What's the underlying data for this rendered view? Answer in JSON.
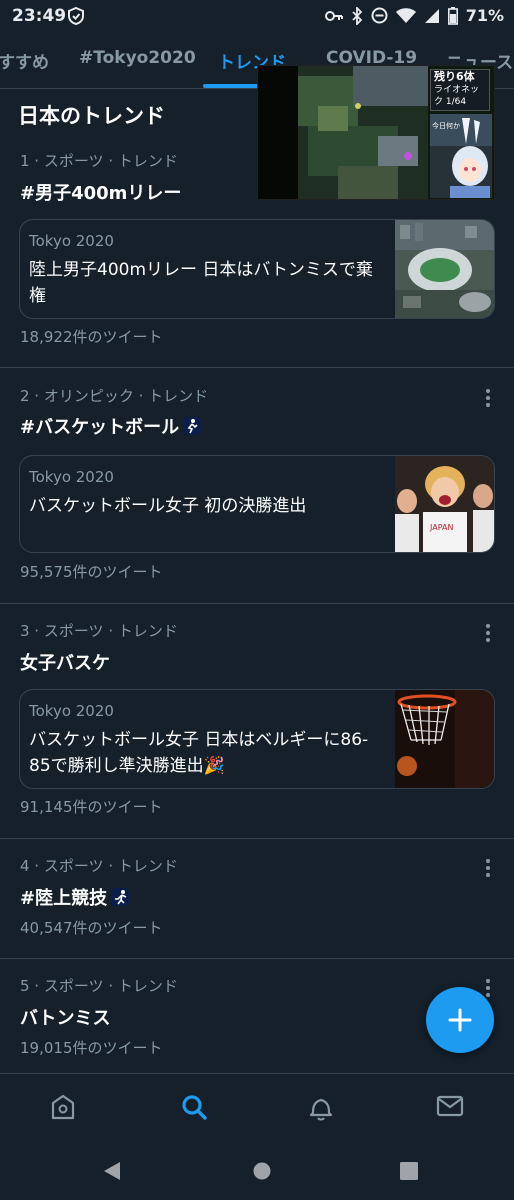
{
  "status_bar": {
    "time": "23:49",
    "battery": "71%"
  },
  "tabs": [
    {
      "label": "すすめ"
    },
    {
      "label": "#Tokyo2020"
    },
    {
      "label": "トレンド",
      "active": true
    },
    {
      "label": "COVID-19"
    },
    {
      "label": "ニュース"
    }
  ],
  "section_title": "日本のトレンド",
  "pip": {
    "rank_title": "残り6体",
    "rank_line": "ライオネック 1/64",
    "chat": "今日何か · シュ"
  },
  "trends": [
    {
      "meta": "1 · スポーツ · トレンド",
      "topic": "#男子400mリレー",
      "card": {
        "source": "Tokyo 2020",
        "text": "陸上男子400mリレー 日本はバトンミスで棄権",
        "image": "stadium-aerial-photo"
      },
      "count": "18,922件のツイート"
    },
    {
      "meta": "2 · オリンピック · トレンド",
      "topic": "#バスケットボール",
      "topic_icon": "basketball-player-emoji",
      "card": {
        "source": "Tokyo 2020",
        "text": "バスケットボール女子 初の決勝進出",
        "image": "japan-team-celebrating-photo"
      },
      "count": "95,575件のツイート"
    },
    {
      "meta": "3 · スポーツ · トレンド",
      "topic": "女子バスケ",
      "card": {
        "source": "Tokyo 2020",
        "text": "バスケットボール女子 日本はベルギーに86-85で勝利し準決勝進出🎉",
        "image": "basketball-hoop-photo"
      },
      "count": "91,145件のツイート"
    },
    {
      "meta": "4 · スポーツ · トレンド",
      "topic": "#陸上競技",
      "topic_icon": "runner-emoji",
      "count": "40,547件のツイート"
    },
    {
      "meta": "5 · スポーツ · トレンド",
      "topic": "バトンミス",
      "count": "19,015件のツイート"
    }
  ],
  "bottom_nav": [
    "home-icon",
    "search-icon",
    "notifications-icon",
    "messages-icon"
  ],
  "colors": {
    "background": "#15202b",
    "accent": "#1d9bf0",
    "muted": "#8899a6",
    "border": "#38444d"
  }
}
